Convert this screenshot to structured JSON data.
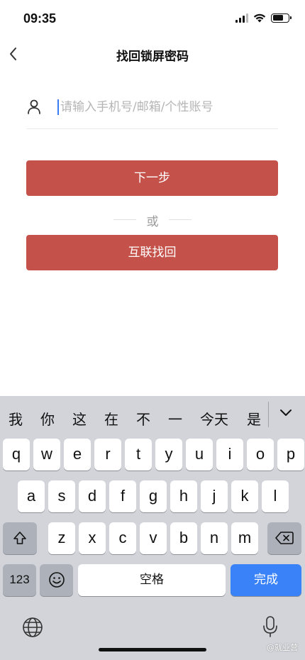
{
  "status_bar": {
    "time": "09:35"
  },
  "nav": {
    "title": "找回锁屏密码"
  },
  "form": {
    "account_placeholder": "请输入手机号/邮箱/个性账号",
    "account_value": ""
  },
  "actions": {
    "next_label": "下一步",
    "or_label": "或",
    "mutual_recover_label": "互联找回"
  },
  "keyboard": {
    "candidates": [
      "我",
      "你",
      "这",
      "在",
      "不",
      "一",
      "今天",
      "是"
    ],
    "row1": [
      "q",
      "w",
      "e",
      "r",
      "t",
      "y",
      "u",
      "i",
      "o",
      "p"
    ],
    "row2": [
      "a",
      "s",
      "d",
      "f",
      "g",
      "h",
      "j",
      "k",
      "l"
    ],
    "row3": [
      "z",
      "x",
      "c",
      "v",
      "b",
      "n",
      "m"
    ],
    "numbers_label": "123",
    "space_label": "空格",
    "done_label": "完成"
  },
  "watermark": "@就业营",
  "colors": {
    "primary_button": "#c5524a",
    "done_key": "#3a82f7",
    "keyboard_bg": "#d2d4da"
  }
}
